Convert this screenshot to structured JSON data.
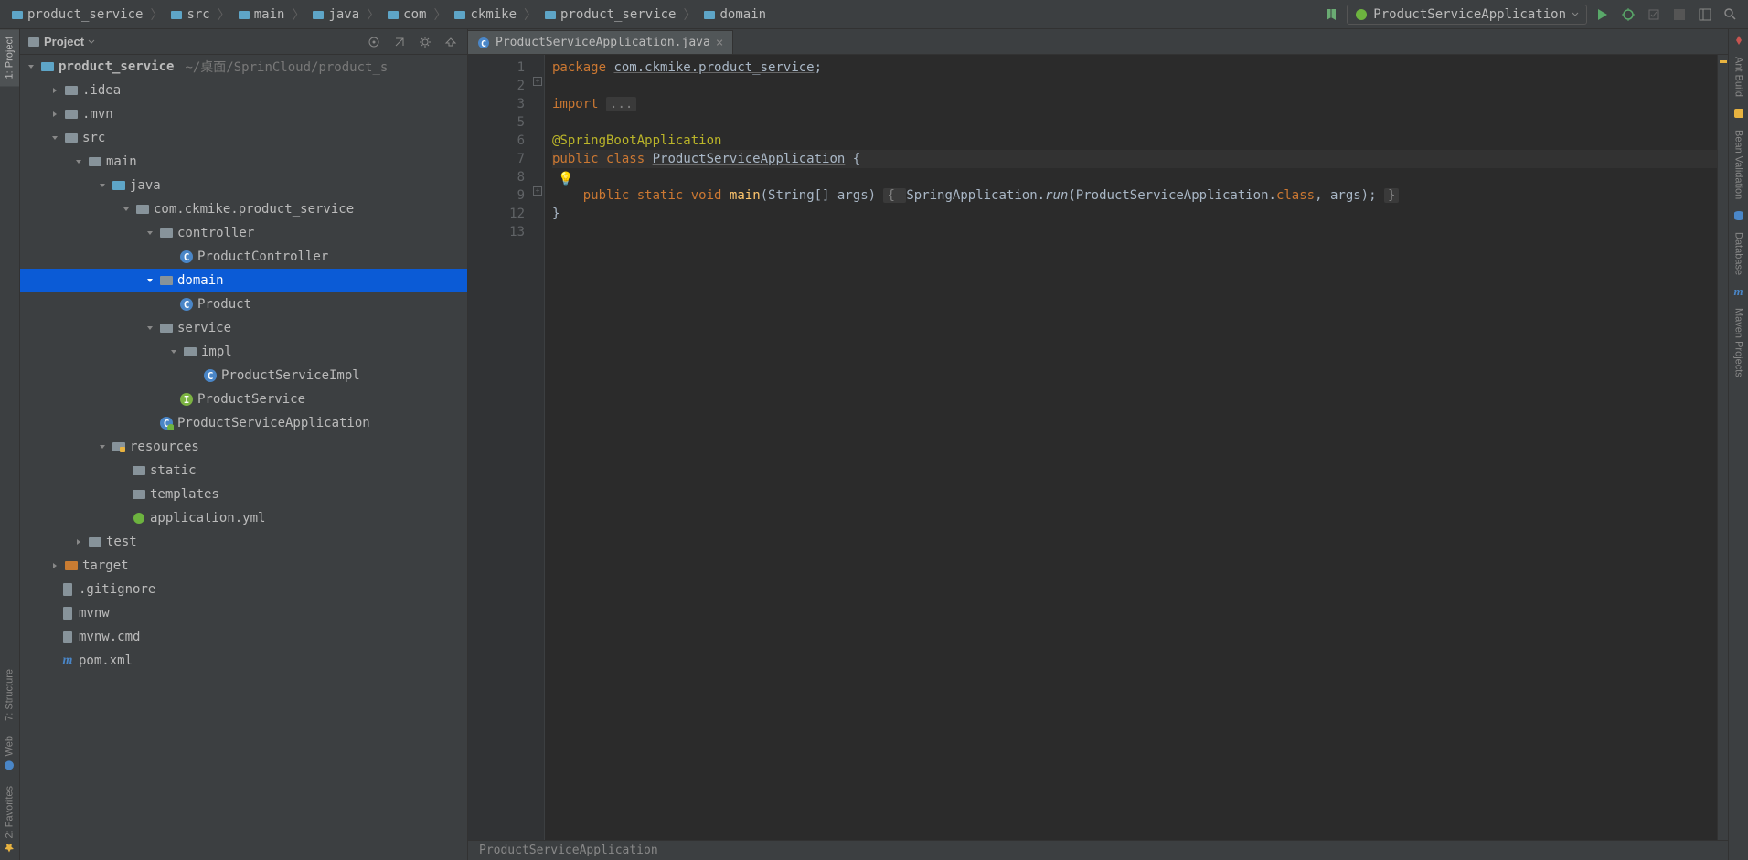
{
  "breadcrumbs": [
    "product_service",
    "src",
    "main",
    "java",
    "com",
    "ckmike",
    "product_service",
    "domain"
  ],
  "runconfig": "ProductServiceApplication",
  "left_tabs": {
    "project": "1: Project",
    "structure": "7: Structure",
    "web": "Web",
    "fav": "2: Favorites"
  },
  "right_tabs": {
    "ant": "Ant Build",
    "bean": "Bean Validation",
    "db": "Database",
    "maven": "Maven Projects"
  },
  "proj_title": "Project",
  "tree": {
    "root": {
      "label": "product_service",
      "meta": "~/桌面/SprinCloud/product_s"
    },
    "idea": ".idea",
    "mvn": ".mvn",
    "src": "src",
    "main": "main",
    "java": "java",
    "pkg": "com.ckmike.product_service",
    "controller": "controller",
    "pc": "ProductController",
    "domain": "domain",
    "product": "Product",
    "service": "service",
    "impl": "impl",
    "psimpl": "ProductServiceImpl",
    "ps": "ProductService",
    "psapp": "ProductServiceApplication",
    "resources": "resources",
    "static": "static",
    "templates": "templates",
    "appyml": "application.yml",
    "test": "test",
    "target": "target",
    "gitignore": ".gitignore",
    "mvnw": "mvnw",
    "mvnwcmd": "mvnw.cmd",
    "pom": "pom.xml"
  },
  "tab": {
    "name": "ProductServiceApplication.java"
  },
  "gutter": [
    "1",
    "2",
    "3",
    "5",
    "6",
    "7",
    "8",
    "9",
    "12",
    "13"
  ],
  "code": {
    "l1_pkg": "package",
    "l1_pkgn": "com.ckmike.product_service",
    "l3_imp": "import",
    "l3_dots": "...",
    "l6_ann": "@SpringBootApplication",
    "l7_pub": "public",
    "l7_cls": "class",
    "l7_name": "ProductServiceApplication",
    "l7_brace": " {",
    "l9_pub": "public",
    "l9_static": "static",
    "l9_void": "void",
    "l9_main": "main",
    "l9_args": "(String[] args) ",
    "l9_b1": "{ ",
    "l9_sa": "SpringApplication.",
    "l9_run": "run",
    "l9_p1": "(",
    "l9_cls": "ProductServiceApplication",
    "l9_dc": ".",
    "l9_clskw": "class",
    "l9_rest": ", args); ",
    "l9_b2": "}",
    "l12": "}"
  },
  "bot_crumb": "ProductServiceApplication"
}
